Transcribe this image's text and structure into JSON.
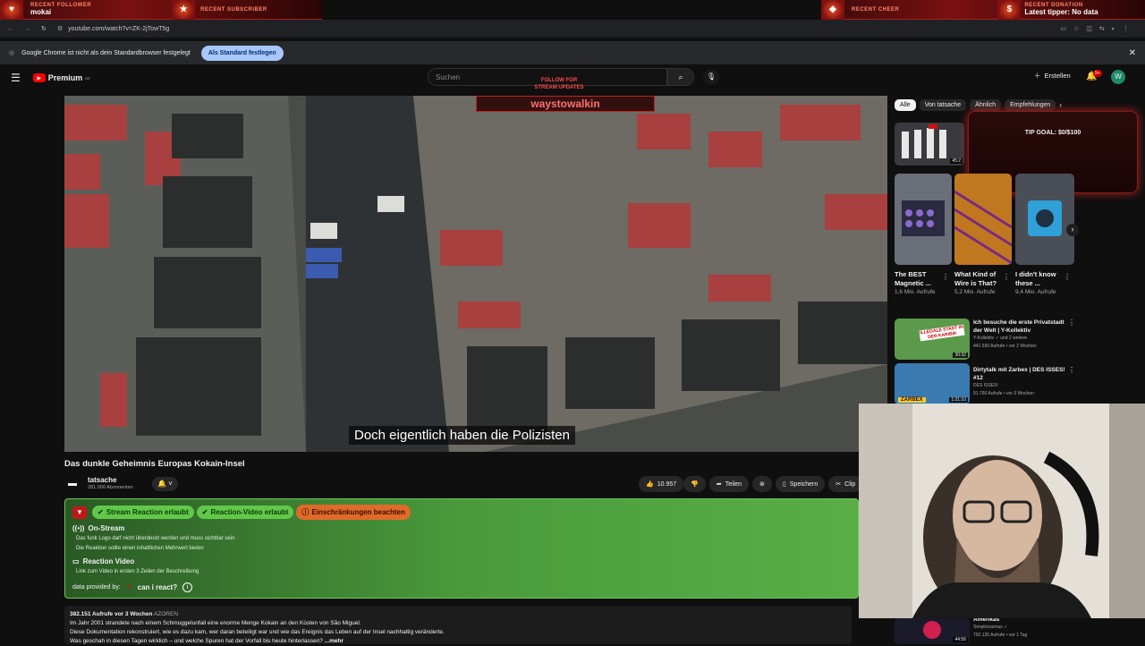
{
  "overlay": {
    "recent_follower_caption": "RECENT FOLLOWER",
    "recent_follower_name": "mokai",
    "recent_subscriber_caption": "RECENT SUBSCRIBER",
    "recent_cheer_caption": "RECENT CHEER",
    "recent_donation_caption": "RECENT DONATION",
    "latest_tipper": "Latest tipper: No data",
    "follow_line1": "FOLLOW FOR",
    "follow_line2": "STREAM UPDATES",
    "channel_name": "waystowalkin",
    "tip_goal": "TIP GOAL: $0/$100"
  },
  "browser": {
    "url": "youtube.com/watch?v=ZK-2jTowT5g",
    "infobar_text": "Google Chrome ist nicht als dein Standardbrowser festgelegt",
    "infobar_button": "Als Standard festlegen"
  },
  "youtube": {
    "logo": "Premium",
    "logo_sup": "DE",
    "search_placeholder": "Suchen",
    "create_label": "Erstellen",
    "notif_count": "9+",
    "avatar_letter": "W"
  },
  "video": {
    "subtitle": "Doch eigentlich haben die Polizisten",
    "title": "Das dunkle Geheimnis Europas Kokain-Insel",
    "channel": "tatsache",
    "subscribers": "281.000 Abonnenten",
    "likes": "10.957",
    "share": "Teilen",
    "save": "Speichern",
    "clip": "Clip",
    "views_date": "382.151 Aufrufe  vor 3 Wochen",
    "tag": "AZOREN",
    "desc1": "Im Jahr 2001 strandete nach einem Schmuggelunfall eine enorme Menge Kokain an den Küsten von São Miguel.",
    "desc2": "Diese Dokumentation rekonstruiert, wie es dazu kam, wer daran beteiligt war und wie das Ereignis das Leben auf der Insel nachhaltig veränderte.",
    "desc3": "Was geschah in diesen Tagen wirklich – und welche Spuren hat der Vorfall bis heute hinterlassen?",
    "more": "...mehr"
  },
  "reaction": {
    "badge1": "Stream Reaction erlaubt",
    "badge2": "Reaction-Video erlaubt",
    "badge3": "Einschränkungen beachten",
    "onstream_title": "On-Stream",
    "onstream_r1": "Das funk Logo darf nicht überdeckt werden und muss sichtbar sein",
    "onstream_r2": "Die Reaktion sollte einen inhaltlichen Mehrwert bieten",
    "video_title": "Reaction Video",
    "video_r1": "Link zum Video in ersten 3 Zeilen der Beschreibung",
    "provided": "data provided by:",
    "brand": "can i react?"
  },
  "sidebar": {
    "chips": [
      "Alle",
      "Von tatsache",
      "Ähnlich",
      "Empfehlungen"
    ],
    "shorts": [
      {
        "title": "The BEST Magnetic ...",
        "views": "1,6 Mio. Aufrufe"
      },
      {
        "title": "What Kind of Wire is That?",
        "views": "5,2 Mio. Aufrufe"
      },
      {
        "title": "I didn't know these ...",
        "views": "9,4 Mio. Aufrufe"
      }
    ],
    "videos": [
      {
        "title": "Ich besuche die erste Privatstadt der Welt | Y-Kollektiv",
        "channel": "Y-Kollektiv",
        "extra": "und 2 weitere",
        "meta": "441.930 Aufrufe • vor 2 Wochen",
        "duration": "30:32",
        "thumb_text": "ILLEGALE STADT IN DER KARIBIK"
      },
      {
        "title": "Dirtytalk mit Zarbex | DES ISSES! #12",
        "channel": "DES ISSES!",
        "extra": "",
        "meta": "91.760 Aufrufe • vor 3 Wochen",
        "duration": "1:21:10",
        "thumb_text": "ZARBEX"
      },
      {
        "title": "Amerikas",
        "channel": "Simplicissimus",
        "extra": "",
        "meta": "792.135 Aufrufe • vor 1 Tag",
        "duration": "44:56",
        "thumb_text": ""
      }
    ],
    "top_thumb_time": "45:2"
  }
}
